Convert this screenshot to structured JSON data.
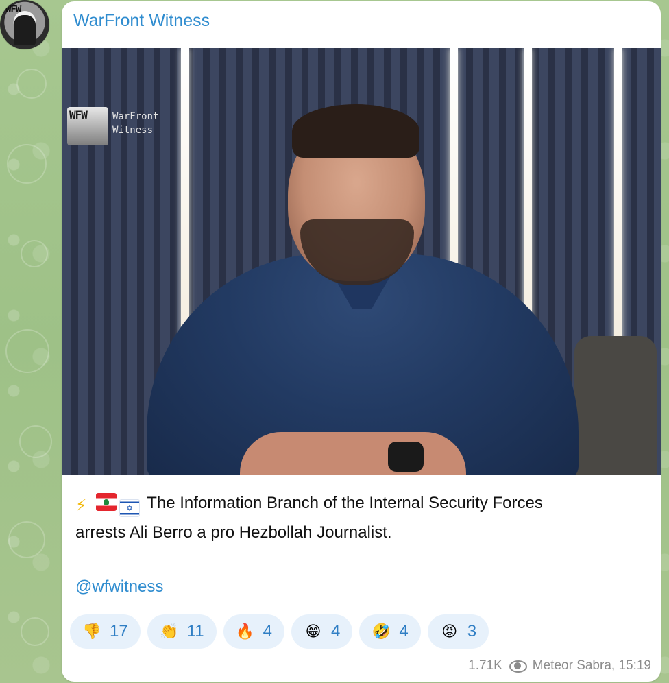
{
  "channel": {
    "name": "WarFront Witness",
    "avatar_icon": "warfront-witness-logo"
  },
  "media": {
    "watermark_logo": "WFW",
    "watermark_text_line1": "WarFront",
    "watermark_text_line2": "Witness"
  },
  "message": {
    "emojis": [
      "⚡",
      "🇱🇧",
      "🇮🇱"
    ],
    "text_line1": "The Information Branch of the Internal Security Forces",
    "text_line2": "arrests Ali Berro a pro Hezbollah Journalist.",
    "link": "@wfwitness"
  },
  "reactions": [
    {
      "emoji": "👎",
      "icon": "thumbs-down-icon",
      "count": "17"
    },
    {
      "emoji": "👏",
      "icon": "clapping-hands-icon",
      "count": "11"
    },
    {
      "emoji": "🔥",
      "icon": "fire-icon",
      "count": "4"
    },
    {
      "emoji": "😁",
      "icon": "grinning-face-icon",
      "count": "4"
    },
    {
      "emoji": "🤣",
      "icon": "rofl-face-icon",
      "count": "4"
    },
    {
      "emoji": "😡",
      "icon": "angry-face-icon",
      "count": "3"
    }
  ],
  "footer": {
    "views": "1.71K",
    "author_time": "Meteor Sabra, 15:19"
  },
  "colors": {
    "accent": "#2f8ccf",
    "reaction_bg": "#e7f1fb",
    "wallpaper": "#a6c48f"
  }
}
